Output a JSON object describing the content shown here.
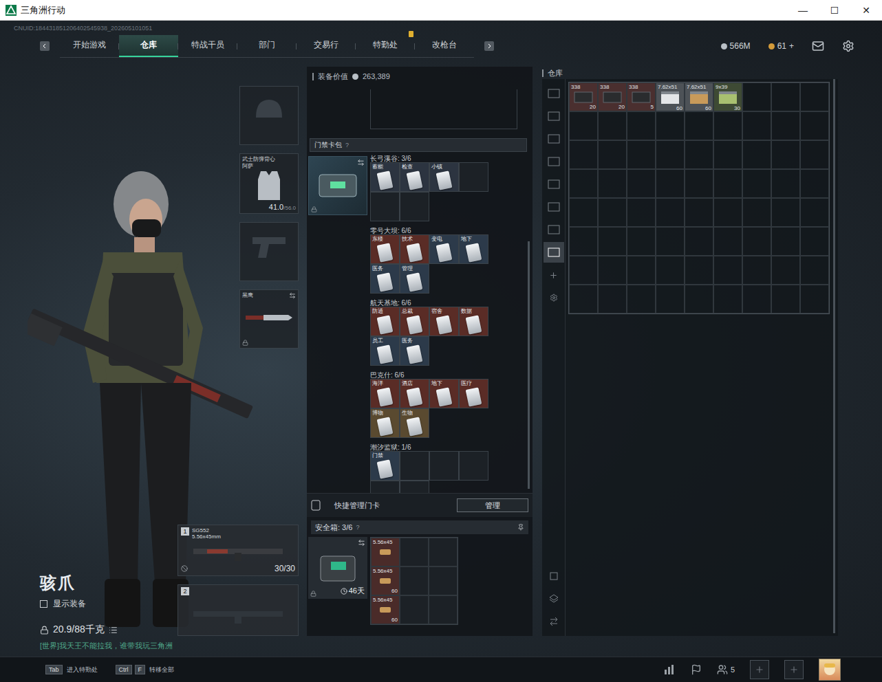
{
  "window": {
    "title": "三角洲行动",
    "controls": [
      "—",
      "☐",
      "✕"
    ]
  },
  "uid": "CNUID:184431851206402545938_202605101051",
  "nav": {
    "tabs": [
      {
        "label": "开始游戏",
        "selected": false,
        "alert": false
      },
      {
        "label": "仓库",
        "selected": true,
        "alert": false
      },
      {
        "label": "特战干员",
        "selected": false,
        "alert": false
      },
      {
        "label": "部门",
        "selected": false,
        "alert": false
      },
      {
        "label": "交易行",
        "selected": false,
        "alert": false
      },
      {
        "label": "特勤处",
        "selected": false,
        "alert": true
      },
      {
        "label": "改枪台",
        "selected": false,
        "alert": false
      }
    ]
  },
  "currency": [
    {
      "amount": "566M",
      "color": "#b9c0c6"
    },
    {
      "amount": "61",
      "plus": "+",
      "color": "#d39b3a"
    }
  ],
  "character": {
    "name": "骇爪",
    "show_gear": {
      "label": "显示装备",
      "checked": false
    },
    "weight": "20.9/88千克",
    "chat": "[世界]我天王不能拉我，谁带我玩三角洲"
  },
  "gear_slots": [
    {
      "kind": "helmet",
      "equipped": false
    },
    {
      "kind": "armor",
      "equipped": true,
      "label": "武士防弹背心",
      "sublabel": "阿萨",
      "durability": "41.0",
      "max": "/56.0"
    },
    {
      "kind": "pistol",
      "equipped": false
    },
    {
      "kind": "melee",
      "equipped": true,
      "label": "黑鹰"
    }
  ],
  "weapons": [
    {
      "index": "1",
      "equipped": true,
      "name": "SG552",
      "caliber": "5.56x45mm",
      "ammo": "30/30"
    },
    {
      "index": "2",
      "equipped": false
    }
  ],
  "loadout": {
    "value_label": "装备价值",
    "value": "263,389"
  },
  "keycard_bag": {
    "title": "门禁卡包",
    "help": "?",
    "groups": [
      {
        "label": "长弓溪谷: 3/6",
        "cards": [
          {
            "label": "蓄能",
            "color": "#2c3440"
          },
          {
            "label": "检查",
            "color": "#2c3440"
          },
          {
            "label": "小镇",
            "color": "#2c3440"
          }
        ]
      },
      {
        "label": "零号大坝: 6/6",
        "cards": [
          {
            "label": "东楼",
            "color": "#5a2c26"
          },
          {
            "label": "技术",
            "color": "#5a2c26"
          },
          {
            "label": "变电",
            "color": "#2c3a4a"
          },
          {
            "label": "地下",
            "color": "#2c3a4a"
          },
          {
            "label": "医务",
            "color": "#2c3a4a"
          },
          {
            "label": "管理",
            "color": "#2c3a4a"
          }
        ]
      },
      {
        "label": "航天基地: 6/6",
        "cards": [
          {
            "label": "防通",
            "color": "#5a2c26"
          },
          {
            "label": "总裁",
            "color": "#5a2c26"
          },
          {
            "label": "宿舍",
            "color": "#5a2c26"
          },
          {
            "label": "数据",
            "color": "#5a2c26"
          },
          {
            "label": "员工",
            "color": "#2c3a4a"
          },
          {
            "label": "医务",
            "color": "#2c3a4a"
          }
        ]
      },
      {
        "label": "巴克什: 6/6",
        "cards": [
          {
            "label": "海洋",
            "color": "#5a2c26"
          },
          {
            "label": "酒店",
            "color": "#5a2c26"
          },
          {
            "label": "地下",
            "color": "#5a2c26"
          },
          {
            "label": "医疗",
            "color": "#5a2c26"
          },
          {
            "label": "博物",
            "color": "#5a4a30"
          },
          {
            "label": "生物",
            "color": "#5a4a30"
          }
        ]
      },
      {
        "label": "潮汐监狱: 1/6",
        "cards": [
          {
            "label": "门禁",
            "color": "#2c3a4a"
          }
        ]
      }
    ]
  },
  "quick_manage": {
    "label": "快捷管理门卡",
    "button": "管理"
  },
  "safe_box": {
    "title": "安全箱: 3/6",
    "help": "?",
    "time": "46天",
    "items": [
      {
        "label": "5.56x45"
      },
      {
        "label": "5.56x45",
        "count": "60"
      },
      {
        "label": "5.56x45",
        "count": "60"
      }
    ]
  },
  "stash": {
    "title": "仓库",
    "tabs": [
      {
        "selected": false
      },
      {
        "selected": false
      },
      {
        "selected": false
      },
      {
        "selected": false
      },
      {
        "selected": false
      },
      {
        "selected": false
      },
      {
        "selected": false
      },
      {
        "selected": true
      }
    ],
    "items": [
      {
        "caliber": "338",
        "count": "20",
        "kind": "dark",
        "color": "#4a2f2f"
      },
      {
        "caliber": "338",
        "count": "20",
        "kind": "dark",
        "color": "#4a2f2f"
      },
      {
        "caliber": "338",
        "count": "5",
        "kind": "dark",
        "color": "#4a2f2f"
      },
      {
        "caliber": "7.62x51",
        "count": "60",
        "kind": "white",
        "color": "#4d5257"
      },
      {
        "caliber": "7.62x51",
        "count": "60",
        "kind": "tan",
        "color": "#4d5257"
      },
      {
        "caliber": "9x39",
        "count": "30",
        "kind": "green",
        "color": "#3e4a34"
      }
    ]
  },
  "bottom": {
    "hints": [
      {
        "keys": [
          "Tab"
        ],
        "label": "进入特勤处"
      },
      {
        "keys": [
          "Ctrl",
          "F"
        ],
        "label": "转移全部"
      }
    ],
    "friends": "5"
  }
}
